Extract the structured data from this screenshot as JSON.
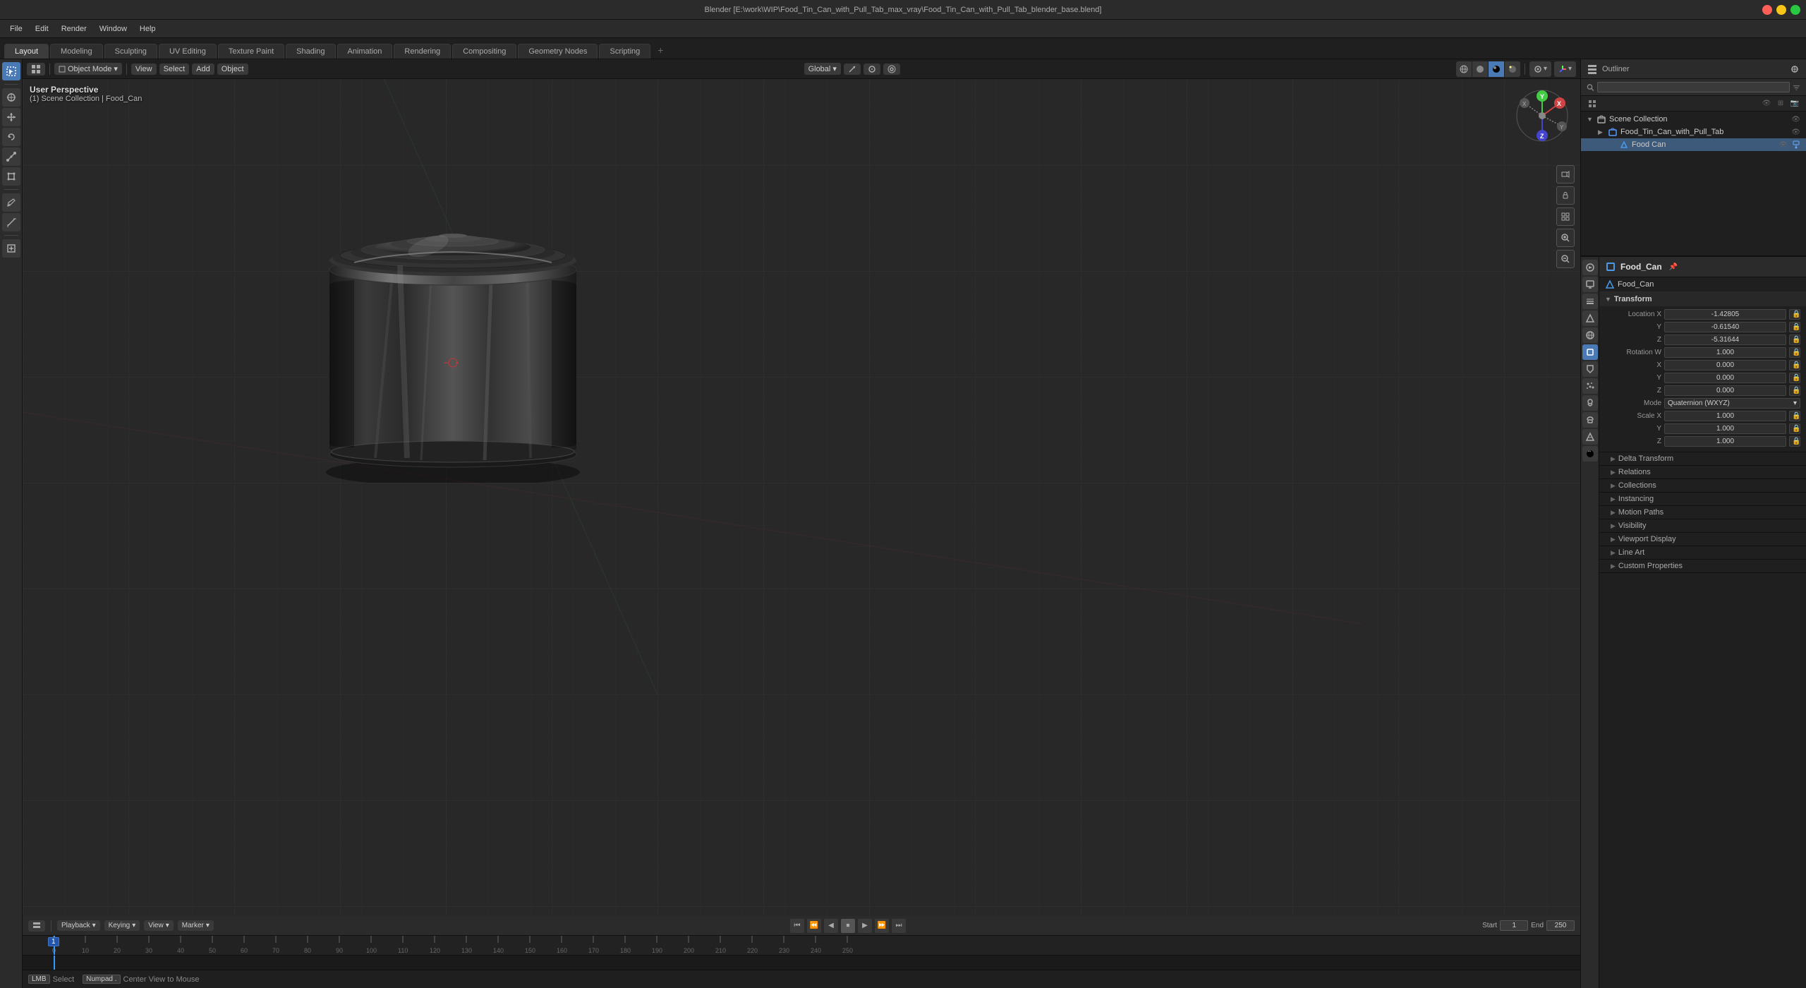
{
  "title_bar": {
    "title": "Blender [E:\\work\\WIP\\Food_Tin_Can_with_Pull_Tab_max_vray\\Food_Tin_Can_with_Pull_Tab_blender_base.blend]"
  },
  "menu": {
    "items": [
      "File",
      "Edit",
      "Render",
      "Window",
      "Help"
    ]
  },
  "workspace_tabs": {
    "tabs": [
      "Layout",
      "Modeling",
      "Sculpting",
      "UV Editing",
      "Texture Paint",
      "Shading",
      "Animation",
      "Rendering",
      "Compositing",
      "Geometry Nodes",
      "Scripting"
    ],
    "active": "Layout"
  },
  "viewport": {
    "mode": "Object Mode",
    "perspective_label": "User Perspective",
    "collection_label": "(1) Scene Collection | Food_Can",
    "transform_dropdown": "Global"
  },
  "nav_gizmo": {
    "x_label": "X",
    "y_label": "Y",
    "z_label": "Z"
  },
  "outliner": {
    "title": "Scene Collection",
    "search_placeholder": "",
    "items": [
      {
        "name": "Scene Collection",
        "type": "collection",
        "depth": 0,
        "expanded": true
      },
      {
        "name": "Food_Tin_Can_with_Pull_Tab",
        "type": "object",
        "depth": 1,
        "expanded": false,
        "active": false
      },
      {
        "name": "Food Can",
        "type": "mesh",
        "depth": 2,
        "expanded": false,
        "active": true
      }
    ]
  },
  "properties": {
    "object_name": "Food_Can",
    "mesh_name": "Food_Can",
    "transform": {
      "label": "Transform",
      "location": {
        "x": "-1.42805",
        "y": "-0.61540",
        "z": "-5.31644"
      },
      "rotation_w": "1.000",
      "rotation_x": "0.000",
      "rotation_y": "0.000",
      "rotation_z": "0.000",
      "mode_label": "Mode",
      "mode_value": "Quaternion (WXYZ)",
      "scale_x": "1.000",
      "scale_y": "1.000",
      "scale_z": "1.000"
    },
    "sections": [
      {
        "name": "Delta Transform",
        "collapsed": true
      },
      {
        "name": "Relations",
        "collapsed": true
      },
      {
        "name": "Collections",
        "collapsed": true
      },
      {
        "name": "Instancing",
        "collapsed": true
      },
      {
        "name": "Motion Paths",
        "collapsed": true
      },
      {
        "name": "Visibility",
        "collapsed": true
      },
      {
        "name": "Viewport Display",
        "collapsed": true
      },
      {
        "name": "Line Art",
        "collapsed": true
      },
      {
        "name": "Custom Properties",
        "collapsed": true
      }
    ]
  },
  "timeline": {
    "playback_label": "Playback",
    "keying_label": "Keying",
    "view_label": "View",
    "marker_label": "Marker",
    "start_label": "Start",
    "start_value": "1",
    "end_label": "End",
    "end_value": "250",
    "current_frame": "1",
    "frame_marks": [
      0,
      10,
      20,
      30,
      40,
      50,
      60,
      70,
      80,
      90,
      100,
      110,
      120,
      130,
      140,
      150,
      160,
      170,
      180,
      190,
      200,
      210,
      220,
      230,
      240,
      250
    ]
  },
  "status_bar": {
    "select_label": "Select",
    "center_label": "Center View to Mouse"
  },
  "icons": {
    "arrow_right": "▶",
    "arrow_down": "▼",
    "arrow_left": "◀",
    "arrow_skip_start": "⏮",
    "arrow_skip_end": "⏭",
    "play": "▶",
    "play_reverse": "◀",
    "stop": "⏹",
    "key_icon": "⬥",
    "gear": "⚙",
    "eye": "👁",
    "close": "✕",
    "filter": "⊞",
    "plus": "+",
    "minus": "−",
    "search": "🔍",
    "lock": "🔒",
    "camera": "📷",
    "sphere": "○",
    "cube": "□",
    "lamp": "💡",
    "cursor": "⊕"
  },
  "colors": {
    "accent_blue": "#4a7ab5",
    "active_item": "#3d5a7a",
    "error_red": "#cc2222",
    "green_axis": "#22aa22",
    "blue_axis": "#2244cc",
    "orange_keyframe": "#ffaa00",
    "bg_dark": "#1a1a1a",
    "bg_medium": "#2b2b2b",
    "bg_light": "#3a3a3a",
    "text_normal": "#cccccc",
    "text_dim": "#888888"
  }
}
